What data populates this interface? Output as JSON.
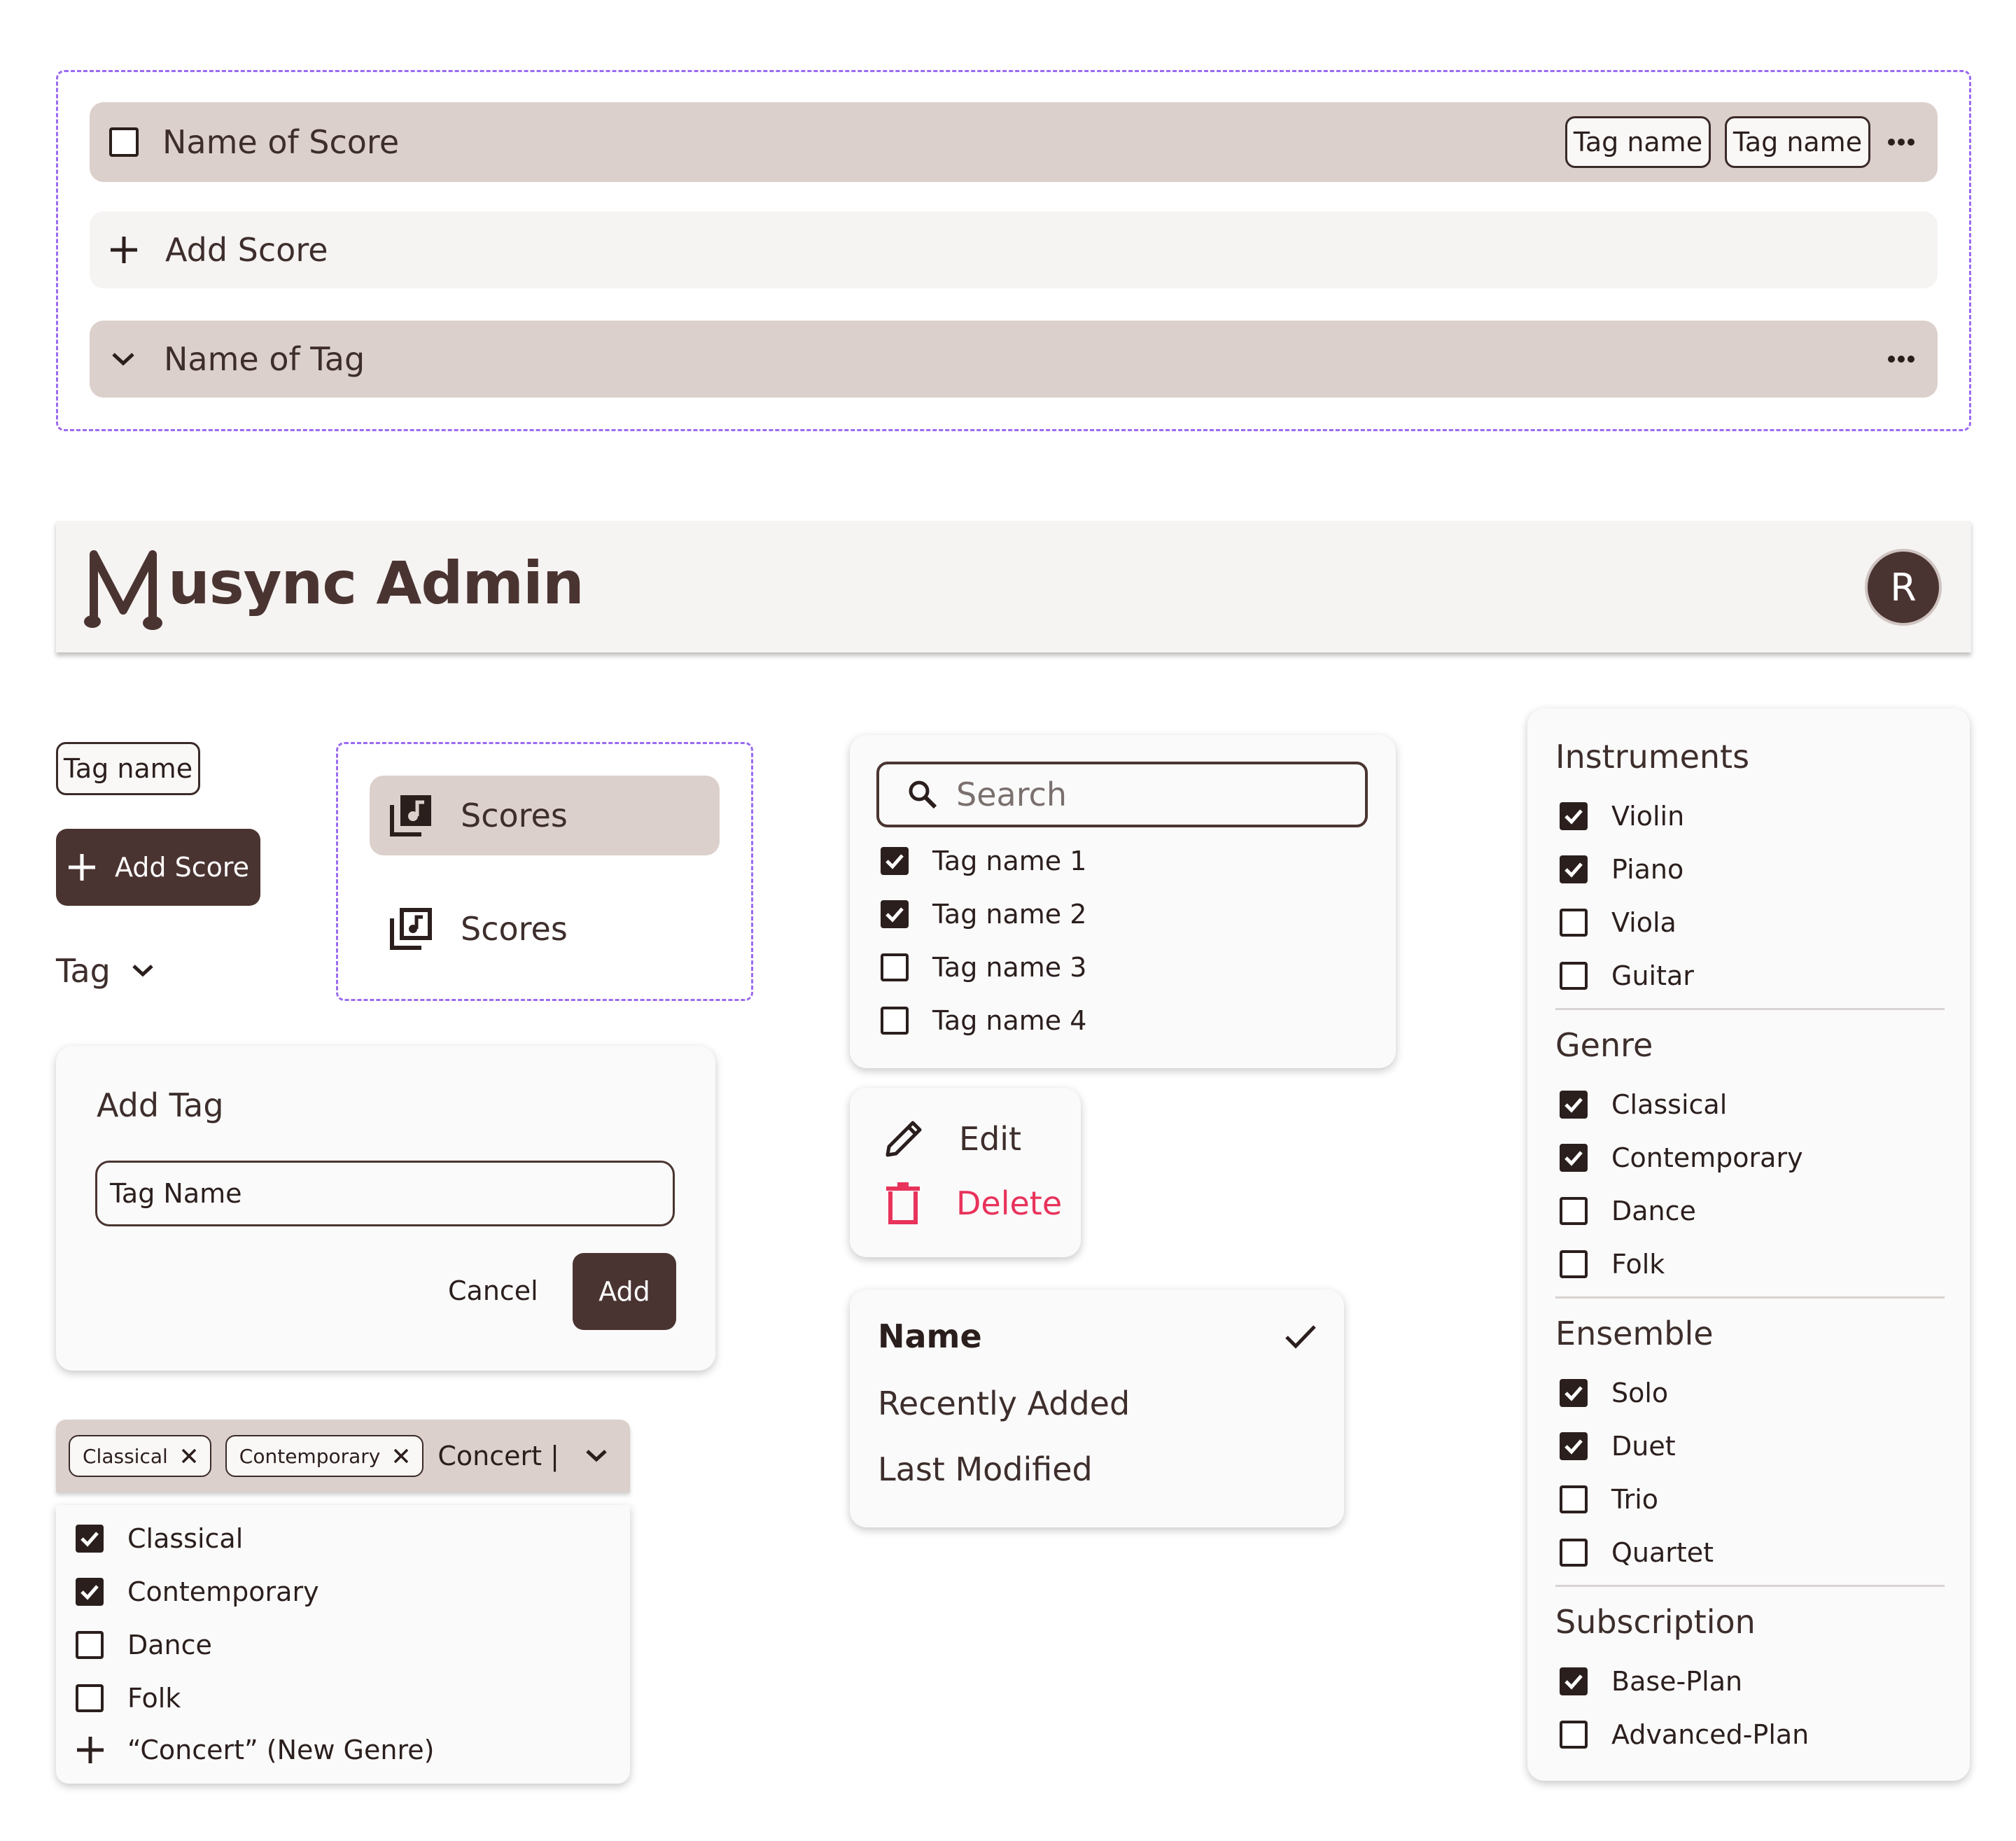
{
  "list_rows": {
    "score_row": {
      "label": "Name of Score",
      "tags": [
        "Tag name",
        "Tag name"
      ]
    },
    "add_score_row": {
      "label": "Add Score"
    },
    "tag_row": {
      "label": "Name of Tag"
    }
  },
  "header": {
    "title": "usync Admin",
    "logo_letter": "M",
    "avatar": "R"
  },
  "left_components": {
    "tag_chip": "Tag name",
    "add_score_button": "Add Score",
    "tag_dropdown": "Tag"
  },
  "nav_items": [
    {
      "label": "Scores",
      "selected": true
    },
    {
      "label": "Scores",
      "selected": false
    }
  ],
  "add_tag_dialog": {
    "title": "Add Tag",
    "input_value": "Tag Name",
    "cancel": "Cancel",
    "add": "Add"
  },
  "multiselect": {
    "chips": [
      "Classical",
      "Contemporary"
    ],
    "input_text": "Concert |",
    "options": [
      {
        "label": "Classical",
        "checked": true
      },
      {
        "label": "Contemporary",
        "checked": true
      },
      {
        "label": "Dance",
        "checked": false
      },
      {
        "label": "Folk",
        "checked": false
      }
    ],
    "add_new": "“Concert” (New Genre)"
  },
  "tag_search": {
    "placeholder": "Search",
    "options": [
      {
        "label": "Tag name 1",
        "checked": true
      },
      {
        "label": "Tag name 2",
        "checked": true
      },
      {
        "label": "Tag name 3",
        "checked": false
      },
      {
        "label": "Tag name 4",
        "checked": false
      }
    ]
  },
  "context_menu": {
    "edit": "Edit",
    "delete": "Delete",
    "delete_color": "#e8335b"
  },
  "sort_menu": {
    "options": [
      {
        "label": "Name",
        "selected": true
      },
      {
        "label": "Recently Added",
        "selected": false
      },
      {
        "label": "Last Modified",
        "selected": false
      }
    ]
  },
  "filters": [
    {
      "title": "Instruments",
      "options": [
        {
          "label": "Violin",
          "checked": true
        },
        {
          "label": "Piano",
          "checked": true
        },
        {
          "label": "Viola",
          "checked": false
        },
        {
          "label": "Guitar",
          "checked": false
        }
      ]
    },
    {
      "title": "Genre",
      "options": [
        {
          "label": "Classical",
          "checked": true
        },
        {
          "label": "Contemporary",
          "checked": true
        },
        {
          "label": "Dance",
          "checked": false
        },
        {
          "label": "Folk",
          "checked": false
        }
      ]
    },
    {
      "title": "Ensemble",
      "options": [
        {
          "label": "Solo",
          "checked": true
        },
        {
          "label": "Duet",
          "checked": true
        },
        {
          "label": "Trio",
          "checked": false
        },
        {
          "label": "Quartet",
          "checked": false
        }
      ]
    },
    {
      "title": "Subscription",
      "options": [
        {
          "label": "Base-Plan",
          "checked": true
        },
        {
          "label": "Advanced-Plan",
          "checked": false
        }
      ]
    }
  ],
  "colors": {
    "primary": "#4a3431",
    "row_bg": "#dcd0cc",
    "dashed": "#9b6bf0"
  }
}
